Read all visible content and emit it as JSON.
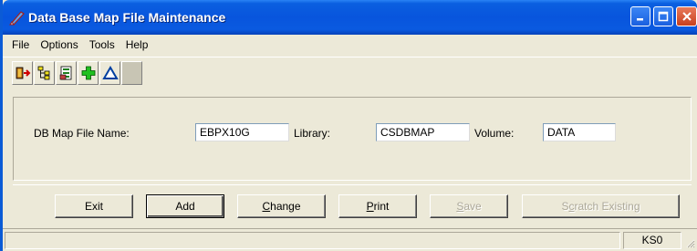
{
  "window": {
    "title": "Data Base Map File Maintenance"
  },
  "menu": [
    "File",
    "Options",
    "Tools",
    "Help"
  ],
  "toolbar": {
    "icons": [
      "exit-door-icon",
      "tree-icon",
      "records-icon",
      "add-plus-icon",
      "delta-icon",
      "blank-icon"
    ]
  },
  "form": {
    "map_file_label": "DB Map File Name:",
    "map_file_value": "EBPX10G",
    "library_label": "Library:",
    "library_value": "CSDBMAP",
    "volume_label": "Volume:",
    "volume_value": "DATA"
  },
  "buttons": {
    "exit": "Exit",
    "add": "Add",
    "change_ul": "C",
    "change_rest": "hange",
    "print_ul": "P",
    "print_rest": "rint",
    "save_ul": "S",
    "save_rest": "ave",
    "scratch_pre": "S",
    "scratch_ul": "c",
    "scratch_rest": "ratch Existing"
  },
  "status": {
    "right": "KS0"
  },
  "colors": {
    "titlebar": "#0855dd",
    "face": "#ece9d8",
    "close": "#c8401e"
  }
}
